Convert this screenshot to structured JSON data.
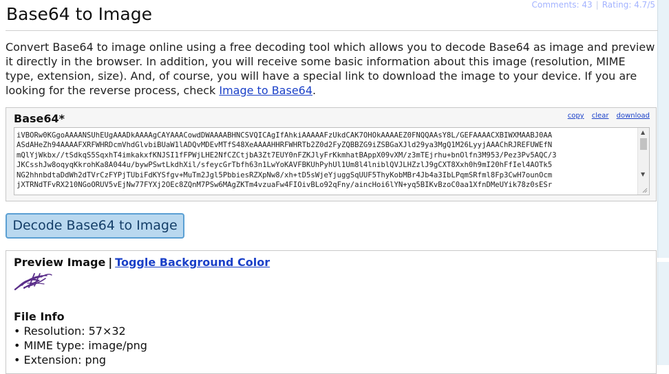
{
  "meta": {
    "comments": "Comments: 43",
    "rating": "Rating: 4.7/5"
  },
  "page": {
    "title": "Base64 to Image",
    "intro": "Convert Base64 to image online using a free decoding tool which allows you to decode Base64 as image and preview it directly in the browser. In addition, you will receive some basic information about this image (resolution, MIME type, extension, size). And, of course, you will have a special link to download the image to your device. If you are looking for the reverse process, check ",
    "intro_link": "Image to Base64",
    "intro_end": "."
  },
  "base64": {
    "label": "Base64*",
    "actions": {
      "copy": "copy",
      "clear": "clear",
      "download": "download"
    },
    "value": "iVBORw0KGgoAAAANSUhEUgAAADkAAAAgCAYAAACowdDWAAAABHNCSVQICAgIfAhkiAAAAAFzUkdCAK7OHOkAAAAEZ0FNQQAAsY8L/GEFAAAACXBIWXMAABJ0AA\nASdAHeZh94AAAAFXRFWHRDcmVhdGlvbiBUaW1lADQvMDEvMTfS48XeAAAAHHRFWHRTb2Z0d2FyZQBBZG9iZSBGaXJld29ya3MgQ1M26LyyjAAAChRJREFUWEfN\nmQlYjWkbx//tSdkqS5SqxhT4imkakxfKNJSI1fFPWjLHE2NfCZCtjbA3Zt7EUY0nFZKJlyFrKkmhatBAppX09vXM/z3mTEjrhu+bnOlfn3M953/Pez3Pv5AQC/3\nJKCsshJw8oqyqKkrohKa8A044u/bywPSwtLkdhXil/sfeycGrTbfh63n1LwYoKAVFBKUhPyhUl1Um8l4lniblQVJLHZzlJ9gCXT8Xxh0h9mI20hFfIel4AOTk5\nNG2hhnbdtaDdWh2dTVrCzFYPjTUbiFdKYSfgv+MuTm2Jgl5PbbiesRZXpNw8/xh+tD5sWjeYjuggSqUUF5ThyKobMBr4Jb4a3IbLPqmSRfml8Fp3CwH7ounOcm\njXTRNdTFvRX210NGoORUV5vEjNw77FYXj2OEc8ZQnM7PSw6MAgZKTm4vzuaFw4FIOivBLo92qFny/aincHoi6lYN+yq5BIKvBzoC0aa1XfnDMeUYik78z0sESr"
  },
  "decode_button": "Decode Base64 to Image",
  "preview": {
    "label": "Preview Image",
    "separator": "|",
    "toggle": "Toggle Background Color",
    "file_info_title": "File Info",
    "resolution": "Resolution: 57×32",
    "mime": "MIME type: image/png",
    "extension": "Extension: png"
  },
  "colors": {
    "link": "#1a40c8",
    "meta": "#a3b3ff",
    "button_bg": "#b9d8ef",
    "button_border": "#5a9fd3",
    "logo": "#5b2f8a",
    "rail": "#e8f2f8"
  }
}
